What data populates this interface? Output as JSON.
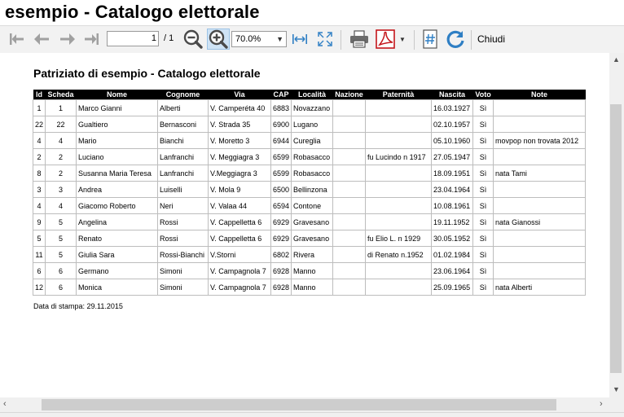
{
  "window": {
    "title": "esempio - Catalogo elettorale"
  },
  "toolbar": {
    "page_current": "1",
    "page_total": "/ 1",
    "zoom": "70.0%",
    "close_label": "Chiudi",
    "icons": [
      "first-page-icon",
      "prev-page-icon",
      "next-page-icon",
      "last-page-icon",
      "zoom-out-icon",
      "zoom-in-icon",
      "fit-width-icon",
      "fit-page-icon",
      "print-icon",
      "pdf-icon",
      "dropdown-arrow-icon",
      "page-number-icon",
      "refresh-icon"
    ]
  },
  "document": {
    "title": "Patriziato di esempio - Catalogo elettorale",
    "columns": [
      "Id",
      "Scheda",
      "Nome",
      "Cognome",
      "Via",
      "CAP",
      "Località",
      "Nazione",
      "Paternità",
      "Nascita",
      "Voto",
      "Note"
    ],
    "rows": [
      [
        "1",
        "1",
        "Marco Gianni",
        "Alberti",
        "V. Camperéta 40",
        "6883",
        "Novazzano",
        "",
        "",
        "16.03.1927",
        "Sì",
        ""
      ],
      [
        "22",
        "22",
        "Gualtiero",
        "Bernasconi",
        "V. Strada 35",
        "6900",
        "Lugano",
        "",
        "",
        "02.10.1957",
        "Sì",
        ""
      ],
      [
        "4",
        "4",
        "Mario",
        "Bianchi",
        "V. Moretto 3",
        "6944",
        "Cureglia",
        "",
        "",
        "05.10.1960",
        "Sì",
        "movpop non trovata 2012"
      ],
      [
        "2",
        "2",
        "Luciano",
        "Lanfranchi",
        "V. Meggiagra 3",
        "6599",
        "Robasacco",
        "",
        "fu Lucindo n 1917",
        "27.05.1947",
        "Sì",
        ""
      ],
      [
        "8",
        "2",
        "Susanna Maria Teresa",
        "Lanfranchi",
        "V.Meggiagra 3",
        "6599",
        "Robasacco",
        "",
        "",
        "18.09.1951",
        "Sì",
        "nata Tami"
      ],
      [
        "3",
        "3",
        "Andrea",
        "Luiselli",
        "V. Mola 9",
        "6500",
        "Bellinzona",
        "",
        "",
        "23.04.1964",
        "Sì",
        ""
      ],
      [
        "4",
        "4",
        "Giacomo Roberto",
        "Neri",
        "V. Valaa 44",
        "6594",
        "Contone",
        "",
        "",
        "10.08.1961",
        "Sì",
        ""
      ],
      [
        "9",
        "5",
        "Angelina",
        "Rossi",
        "V. Cappelletta 6",
        "6929",
        "Gravesano",
        "",
        "",
        "19.11.1952",
        "Sì",
        "nata Gianossi"
      ],
      [
        "5",
        "5",
        "Renato",
        "Rossi",
        "V. Cappelletta 6",
        "6929",
        "Gravesano",
        "",
        "fu Elio L. n 1929",
        "30.05.1952",
        "Sì",
        ""
      ],
      [
        "11",
        "5",
        "Giulia Sara",
        "Rossi-Bianchi",
        "V.Storni",
        "6802",
        "Rivera",
        "",
        "di Renato  n.1952",
        "01.02.1984",
        "Sì",
        ""
      ],
      [
        "6",
        "6",
        "Germano",
        "Simoni",
        "V. Campagnola 7",
        "6928",
        "Manno",
        "",
        "",
        "23.06.1964",
        "Sì",
        ""
      ],
      [
        "12",
        "6",
        "Monica",
        "Simoni",
        "V. Campagnola 7",
        "6928",
        "Manno",
        "",
        "",
        "25.09.1965",
        "Sì",
        "nata Alberti"
      ]
    ],
    "print_date": "Data di stampa: 29.11.2015"
  }
}
